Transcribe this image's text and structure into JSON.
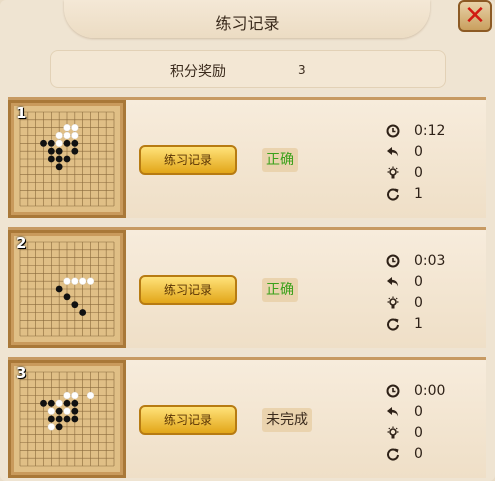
{
  "header": {
    "title": "练习记录",
    "close_icon": "close-icon"
  },
  "score": {
    "label": "积分奖励",
    "value": "3"
  },
  "records": [
    {
      "number": "1",
      "button_label": "练习记录",
      "status": "正确",
      "stats": {
        "time": "0:12",
        "undo": "0",
        "hint": "0",
        "retry": "1"
      },
      "stones": {
        "black": [
          [
            3,
            4
          ],
          [
            4,
            4
          ],
          [
            6,
            4
          ],
          [
            7,
            4
          ],
          [
            7,
            5
          ],
          [
            5,
            5
          ],
          [
            4,
            5
          ],
          [
            4,
            6
          ],
          [
            5,
            6
          ],
          [
            6,
            6
          ],
          [
            5,
            7
          ]
        ],
        "white": [
          [
            6,
            2
          ],
          [
            7,
            2
          ],
          [
            5,
            3
          ],
          [
            4,
            4
          ],
          [
            5,
            4
          ],
          [
            6,
            3
          ],
          [
            7,
            3
          ]
        ]
      }
    },
    {
      "number": "2",
      "button_label": "练习记录",
      "status": "正确",
      "stats": {
        "time": "0:03",
        "undo": "0",
        "hint": "0",
        "retry": "1"
      },
      "stones": {
        "black": [
          [
            5,
            6
          ],
          [
            6,
            7
          ],
          [
            7,
            8
          ],
          [
            8,
            9
          ]
        ],
        "white": [
          [
            6,
            5
          ],
          [
            7,
            5
          ],
          [
            8,
            5
          ],
          [
            9,
            5
          ]
        ]
      }
    },
    {
      "number": "3",
      "button_label": "练习记录",
      "status": "未完成",
      "stats": {
        "time": "0:00",
        "undo": "0",
        "hint": "0",
        "retry": "0"
      },
      "stones": {
        "black": [
          [
            3,
            4
          ],
          [
            4,
            4
          ],
          [
            6,
            4
          ],
          [
            7,
            4
          ],
          [
            7,
            5
          ],
          [
            5,
            5
          ],
          [
            4,
            6
          ],
          [
            5,
            6
          ],
          [
            6,
            6
          ],
          [
            5,
            7
          ],
          [
            7,
            6
          ]
        ],
        "white": [
          [
            7,
            3
          ],
          [
            9,
            3
          ],
          [
            5,
            4
          ],
          [
            6,
            3
          ],
          [
            4,
            5
          ],
          [
            6,
            5
          ],
          [
            4,
            7
          ]
        ]
      }
    }
  ],
  "icons": {
    "time": "clock-icon",
    "undo": "undo-arrow-icon",
    "hint": "lightbulb-icon",
    "retry": "retry-icon"
  },
  "colors": {
    "correct": "#3aa11a",
    "button": "#f2c33f",
    "frame": "#c79a62"
  }
}
